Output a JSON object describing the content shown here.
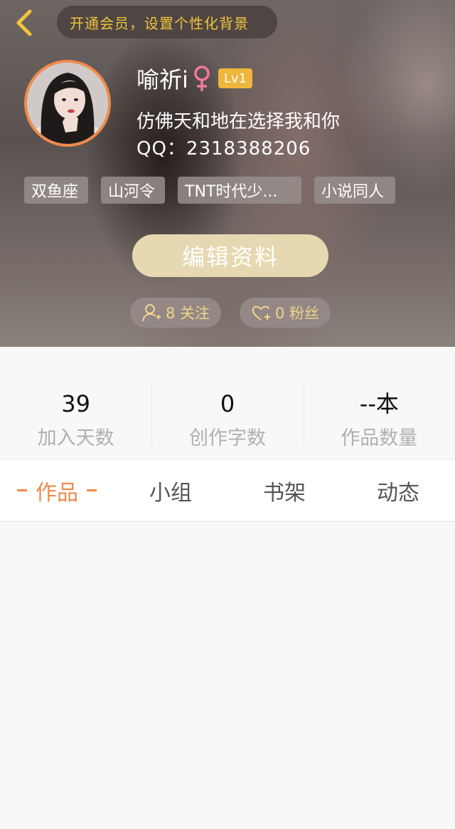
{
  "header": {
    "vip_prompt": "开通会员，设置个性化背景",
    "username": "喻祈i",
    "level": "Lv1",
    "signature": "仿佛天和地在选择我和你",
    "qq": "QQ：2318388206",
    "tags": [
      "双鱼座",
      "山河令",
      "TNT时代少...",
      "小说同人"
    ],
    "edit_label": "编辑资料",
    "following_label": "8 关注",
    "fans_label": "0 粉丝"
  },
  "stats": [
    {
      "value": "39",
      "label": "加入天数"
    },
    {
      "value": "0",
      "label": "创作字数"
    },
    {
      "value": "--本",
      "label": "作品数量"
    }
  ],
  "tabs": [
    {
      "label": "作品",
      "active": true
    },
    {
      "label": "小组",
      "active": false
    },
    {
      "label": "书架",
      "active": false
    },
    {
      "label": "动态",
      "active": false
    }
  ],
  "colors": {
    "accent": "#f08a4b",
    "vip_text": "#f0c43a",
    "level_badge": "#f0b63c",
    "edit_button": "#e6d8b0",
    "gender_female": "#f07aa0"
  },
  "icons": {
    "back": "chevron-left-icon",
    "gender": "female-icon",
    "following": "user-add-icon",
    "fans": "heart-add-icon"
  }
}
